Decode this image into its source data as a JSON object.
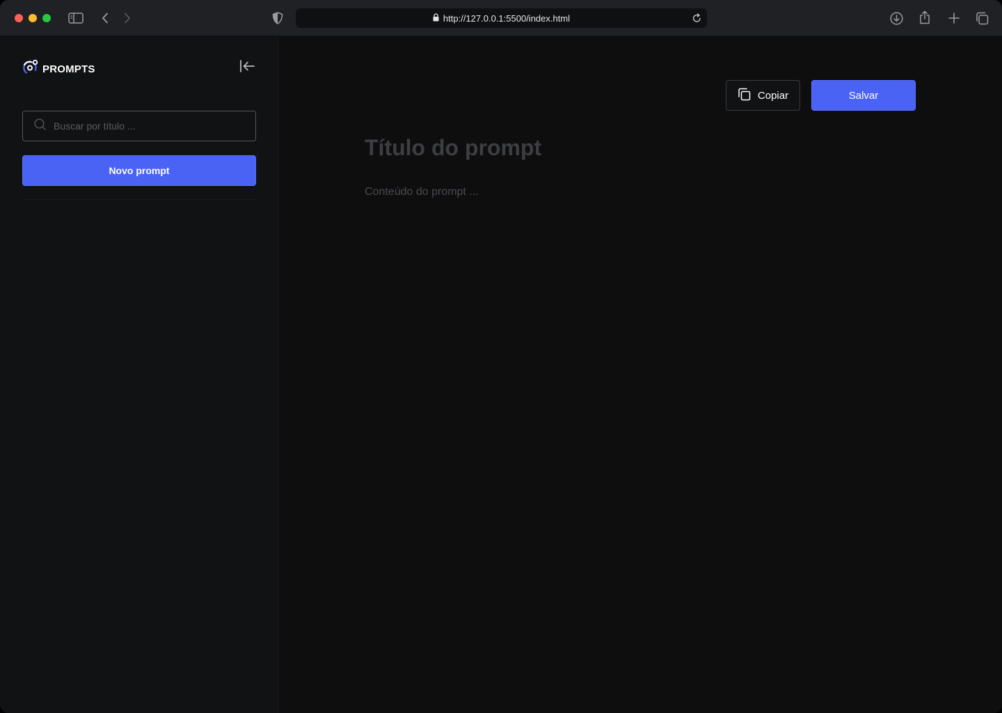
{
  "browser": {
    "url": "http://127.0.0.1:5500/index.html"
  },
  "sidebar": {
    "brand": "PROMPTS",
    "search_placeholder": "Buscar por título ...",
    "new_button": "Novo prompt"
  },
  "main": {
    "copy_button": "Copiar",
    "save_button": "Salvar",
    "title_placeholder": "Título do prompt",
    "content_placeholder": "Conteúdo do prompt ..."
  },
  "colors": {
    "accent": "#4a63f5",
    "background": "#0e0e0f",
    "sidebar": "#111213"
  },
  "icons": {
    "logo": "prompts-logo-icon",
    "collapse": "collapse-sidebar-icon",
    "search": "search-icon",
    "copy": "copy-icon"
  }
}
